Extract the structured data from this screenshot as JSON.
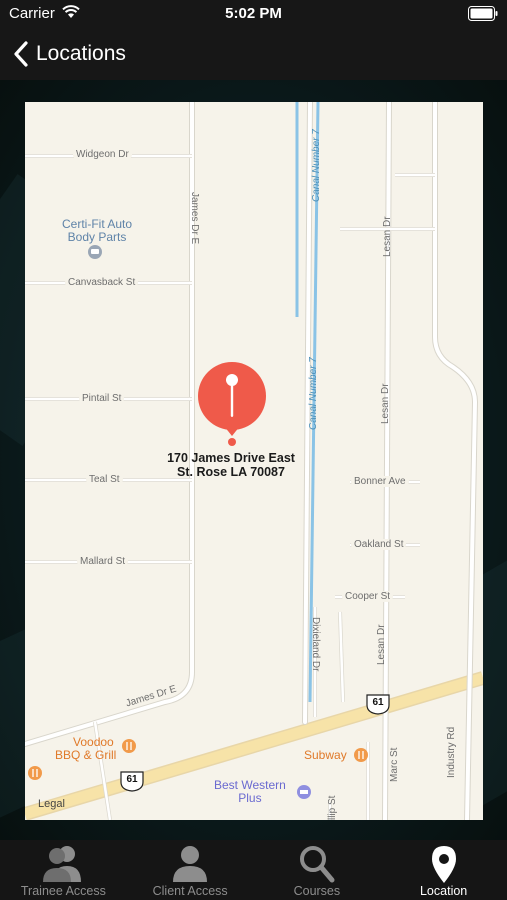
{
  "status_bar": {
    "carrier": "Carrier",
    "time": "5:02 PM"
  },
  "nav": {
    "title": "Locations"
  },
  "map": {
    "streets": {
      "widgeon": "Widgeon Dr",
      "canvasback": "Canvasback St",
      "pintail": "Pintail St",
      "teal": "Teal St",
      "mallard": "Mallard St",
      "james_dr_e_vertical": "James Dr E",
      "james_dr_e_diag": "James Dr E",
      "canal_top": "Canal Number 7",
      "canal_mid": "Canal Number 7",
      "lesan_top": "Lesan Dr",
      "lesan_mid": "Lesan Dr",
      "lesan_bottom": "Lesan Dr",
      "bonner": "Bonner Ave",
      "oakland": "Oakland St",
      "cooper": "Cooper St",
      "dixieland": "Dixieland Dr",
      "marc": "Marc St",
      "industry": "Industry Rd",
      "phillip_partial": "llip St"
    },
    "pois": {
      "certifit": "Certi-Fit Auto Body Parts",
      "voodoo_line1": "Voodoo",
      "voodoo_line2": "BBQ & Grill",
      "subway": "Subway",
      "bestwestern_line1": "Best Western",
      "bestwestern_line2": "Plus"
    },
    "highway_shields": [
      "61",
      "61"
    ],
    "pin_address_line1": "170 James Drive East",
    "pin_address_line2": "St. Rose LA 70087",
    "legal": "Legal",
    "colors": {
      "pin": "#ef5a4a",
      "water": "#8ac3e6",
      "highway": "#f5dc9b",
      "land": "#f6f3ea"
    }
  },
  "tabs": [
    {
      "label": "Trainee Access",
      "icon": "users-icon",
      "active": false
    },
    {
      "label": "Client Access",
      "icon": "user-icon",
      "active": false
    },
    {
      "label": "Courses",
      "icon": "search-icon",
      "active": false
    },
    {
      "label": "Location",
      "icon": "location-pin-icon",
      "active": true
    }
  ]
}
